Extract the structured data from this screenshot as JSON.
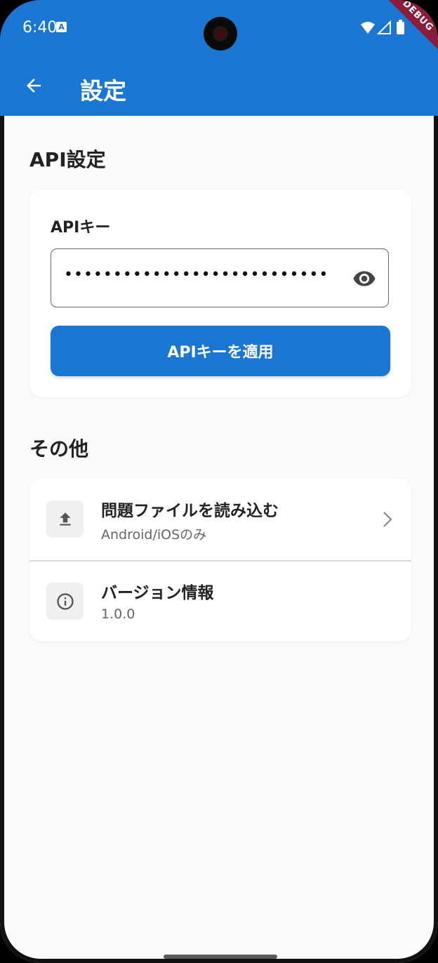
{
  "status_bar": {
    "time": "6:40",
    "notification_icon": "A",
    "debug_label": "DEBUG"
  },
  "app_bar": {
    "title": "設定",
    "back_icon": "arrow-back-icon"
  },
  "api_section": {
    "heading": "API設定",
    "field_label": "APIキー",
    "field_value": "•••••••••••••••••••••••••••",
    "visibility_icon": "eye-icon",
    "apply_button_label": "APIキーを適用"
  },
  "other_section": {
    "heading": "その他",
    "items": [
      {
        "title": "問題ファイルを読み込む",
        "subtitle": "Android/iOSのみ",
        "icon": "upload-icon",
        "trailing_icon": "chevron-right-icon"
      },
      {
        "title": "バージョン情報",
        "subtitle": "1.0.0",
        "icon": "info-icon"
      }
    ]
  },
  "colors": {
    "primary": "#1976d2",
    "background": "#fafafa",
    "card": "#ffffff",
    "debug_banner": "#8b1d3a"
  }
}
